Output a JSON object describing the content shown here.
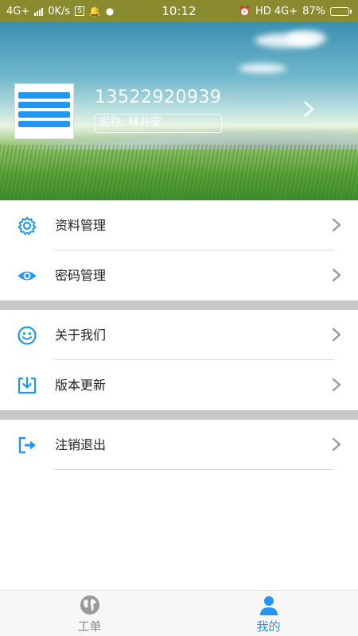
{
  "status_bar": {
    "network_left": "4G+",
    "speed": "0K/s",
    "s_badge": "S",
    "time": "10:12",
    "network_right": "HD 4G+",
    "battery": "87%"
  },
  "profile": {
    "phone": "13522920939",
    "nickname": "昵称: 林井安"
  },
  "menu": {
    "group1": [
      {
        "label": "资料管理",
        "icon": "gear-icon"
      },
      {
        "label": "密码管理",
        "icon": "eye-icon"
      }
    ],
    "group2": [
      {
        "label": "关于我们",
        "icon": "smile-icon"
      },
      {
        "label": "版本更新",
        "icon": "download-icon"
      }
    ],
    "group3": [
      {
        "label": "注销退出",
        "icon": "logout-icon"
      }
    ]
  },
  "bottom_nav": {
    "tabs": [
      {
        "label": "工单",
        "icon": "globe-icon",
        "active": false
      },
      {
        "label": "我的",
        "icon": "person-icon",
        "active": true
      }
    ]
  },
  "colors": {
    "accent": "#2196f3",
    "inactive": "#888888",
    "separator": "#c8c8c8"
  }
}
